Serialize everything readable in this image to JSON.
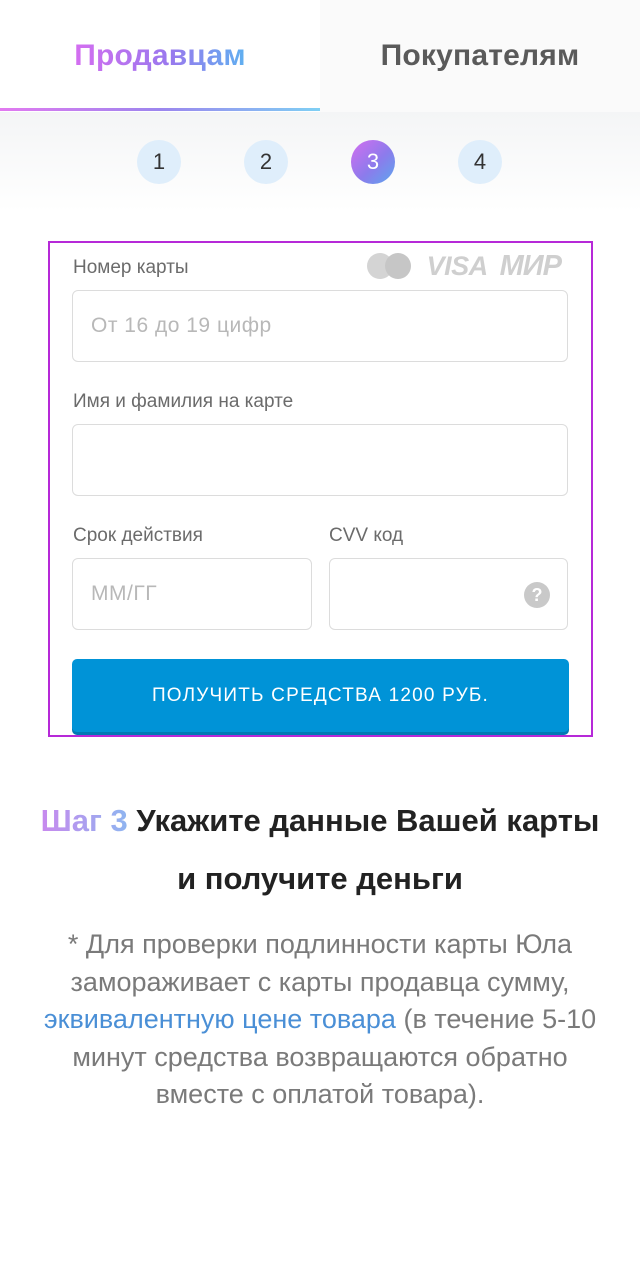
{
  "tabs": [
    {
      "label": "Продавцам",
      "active": true
    },
    {
      "label": "Покупателям",
      "active": false
    }
  ],
  "steps": [
    {
      "label": "1",
      "active": false
    },
    {
      "label": "2",
      "active": false
    },
    {
      "label": "3",
      "active": true
    },
    {
      "label": "4",
      "active": false
    }
  ],
  "form": {
    "card_number_label": "Номер карты",
    "card_number_placeholder": "От 16 до 19 цифр",
    "card_number_value": "",
    "brands": {
      "mastercard": "mastercard-icon",
      "visa": "VISA",
      "mir": "МИР"
    },
    "holder_label": "Имя и фамилия на карте",
    "holder_value": "",
    "expiry_label": "Срок действия",
    "expiry_placeholder": "ММ/ГГ",
    "cvv_label": "CVV код",
    "cvv_value": "",
    "cvv_help": "?",
    "submit_label": "ПОЛУЧИТЬ СРЕДСТВА 1200 РУБ."
  },
  "step_info": {
    "step_prefix": "Шаг 3",
    "title": "Укажите данные Вашей карты и получите деньги",
    "note_before": "* Для проверки подлинности карты Юла замораживает с карты продавца сумму,",
    "note_link": "эквивалентную цене товара",
    "note_after": "(в течение 5-10 минут средства возвращаются обратно вместе с оплатой товара)."
  },
  "colors": {
    "accent_gradient_start": "#d46ef0",
    "accent_gradient_end": "#5ca6ee",
    "button": "#0093d7",
    "form_border": "#b629d8",
    "link": "#4a8fd6"
  }
}
